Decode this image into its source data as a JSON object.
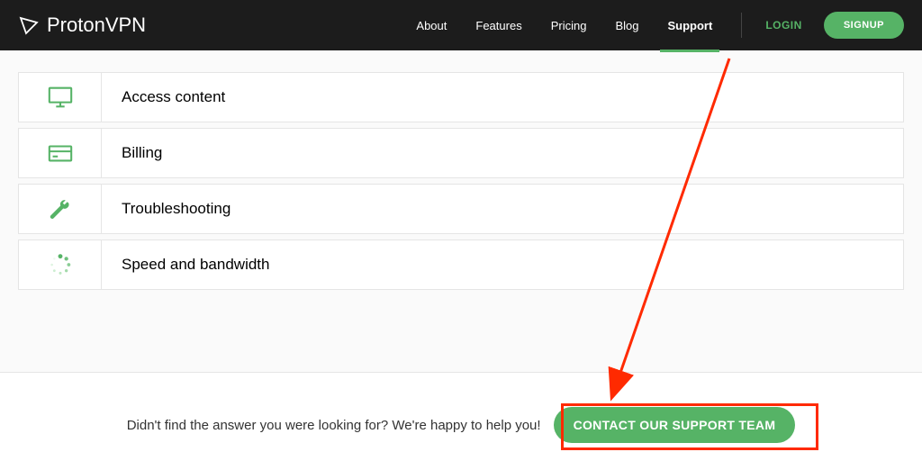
{
  "header": {
    "brand": "ProtonVPN",
    "nav": {
      "about": "About",
      "features": "Features",
      "pricing": "Pricing",
      "blog": "Blog",
      "support": "Support"
    },
    "login": "LOGIN",
    "signup": "SIGNUP"
  },
  "categories": [
    {
      "id": "access-content",
      "label": "Access content",
      "icon": "monitor-icon"
    },
    {
      "id": "billing",
      "label": "Billing",
      "icon": "credit-card-icon"
    },
    {
      "id": "troubleshooting",
      "label": "Troubleshooting",
      "icon": "wrench-icon"
    },
    {
      "id": "speed-bandwidth",
      "label": "Speed and bandwidth",
      "icon": "spinner-icon"
    }
  ],
  "footer": {
    "text": "Didn't find the answer you were looking for? We're happy to help you!",
    "button": "CONTACT OUR SUPPORT TEAM"
  }
}
